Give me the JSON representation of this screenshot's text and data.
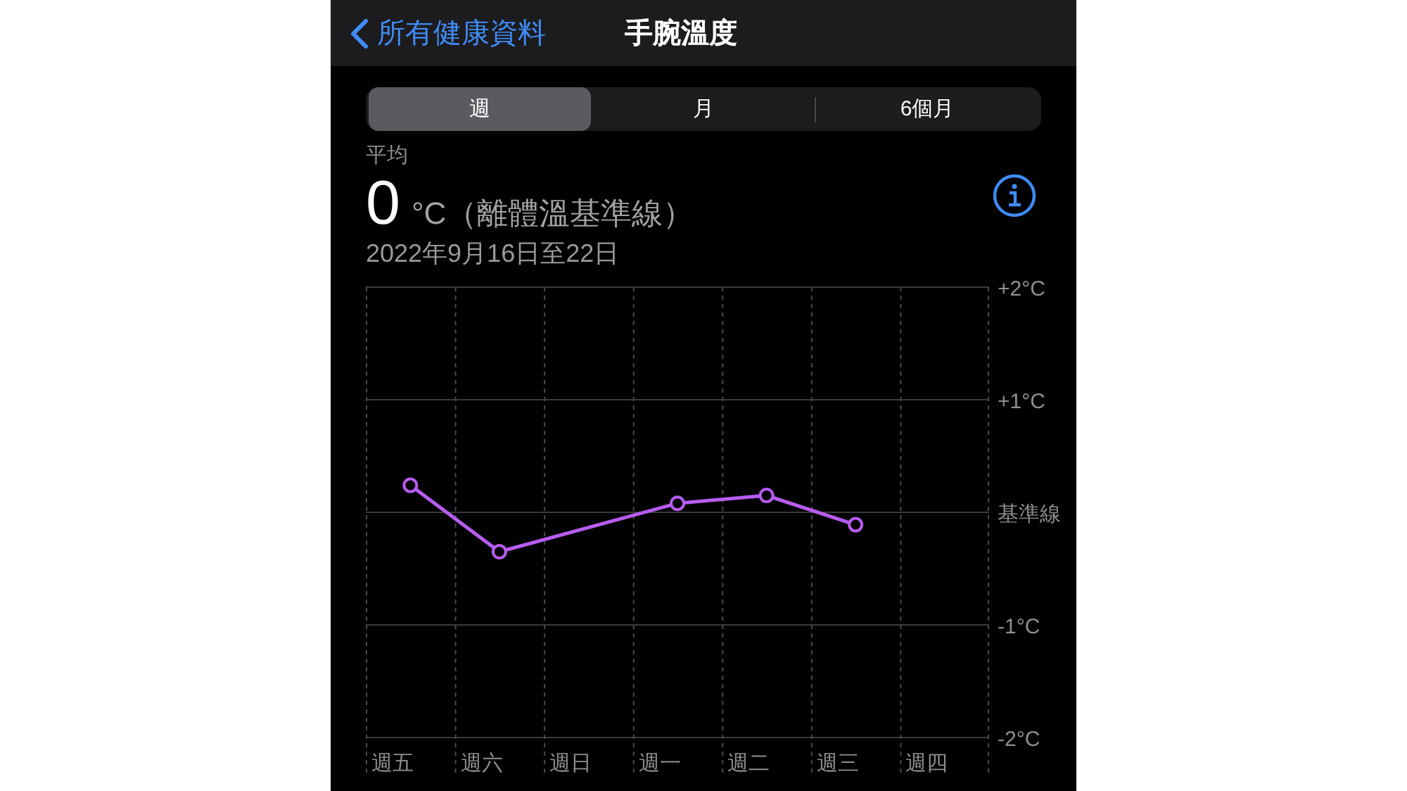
{
  "nav": {
    "back_label": "所有健康資料",
    "title": "手腕溫度"
  },
  "segments": [
    {
      "label": "週",
      "selected": true
    },
    {
      "label": "月",
      "selected": false
    },
    {
      "label": "6個月",
      "selected": false
    }
  ],
  "summary": {
    "label": "平均",
    "value": "0",
    "unit": "°C（離體溫基準線）",
    "date_range": "2022年9月16日至22日"
  },
  "chart_data": {
    "type": "line",
    "categories": [
      "週五",
      "週六",
      "週日",
      "週一",
      "週二",
      "週三",
      "週四"
    ],
    "grid": true,
    "series": [
      {
        "color": "#b75cf0",
        "marker": "circle",
        "values": [
          0.24,
          -0.35,
          null,
          0.08,
          0.15,
          -0.11,
          null
        ]
      }
    ],
    "ylim": [
      -2,
      2
    ],
    "yticks": [
      {
        "value": 2,
        "label": "+2°C"
      },
      {
        "value": 1,
        "label": "+1°C"
      },
      {
        "value": 0,
        "label": "基準線"
      },
      {
        "value": -1,
        "label": "-1°C"
      },
      {
        "value": -2,
        "label": "-2°C"
      }
    ]
  }
}
